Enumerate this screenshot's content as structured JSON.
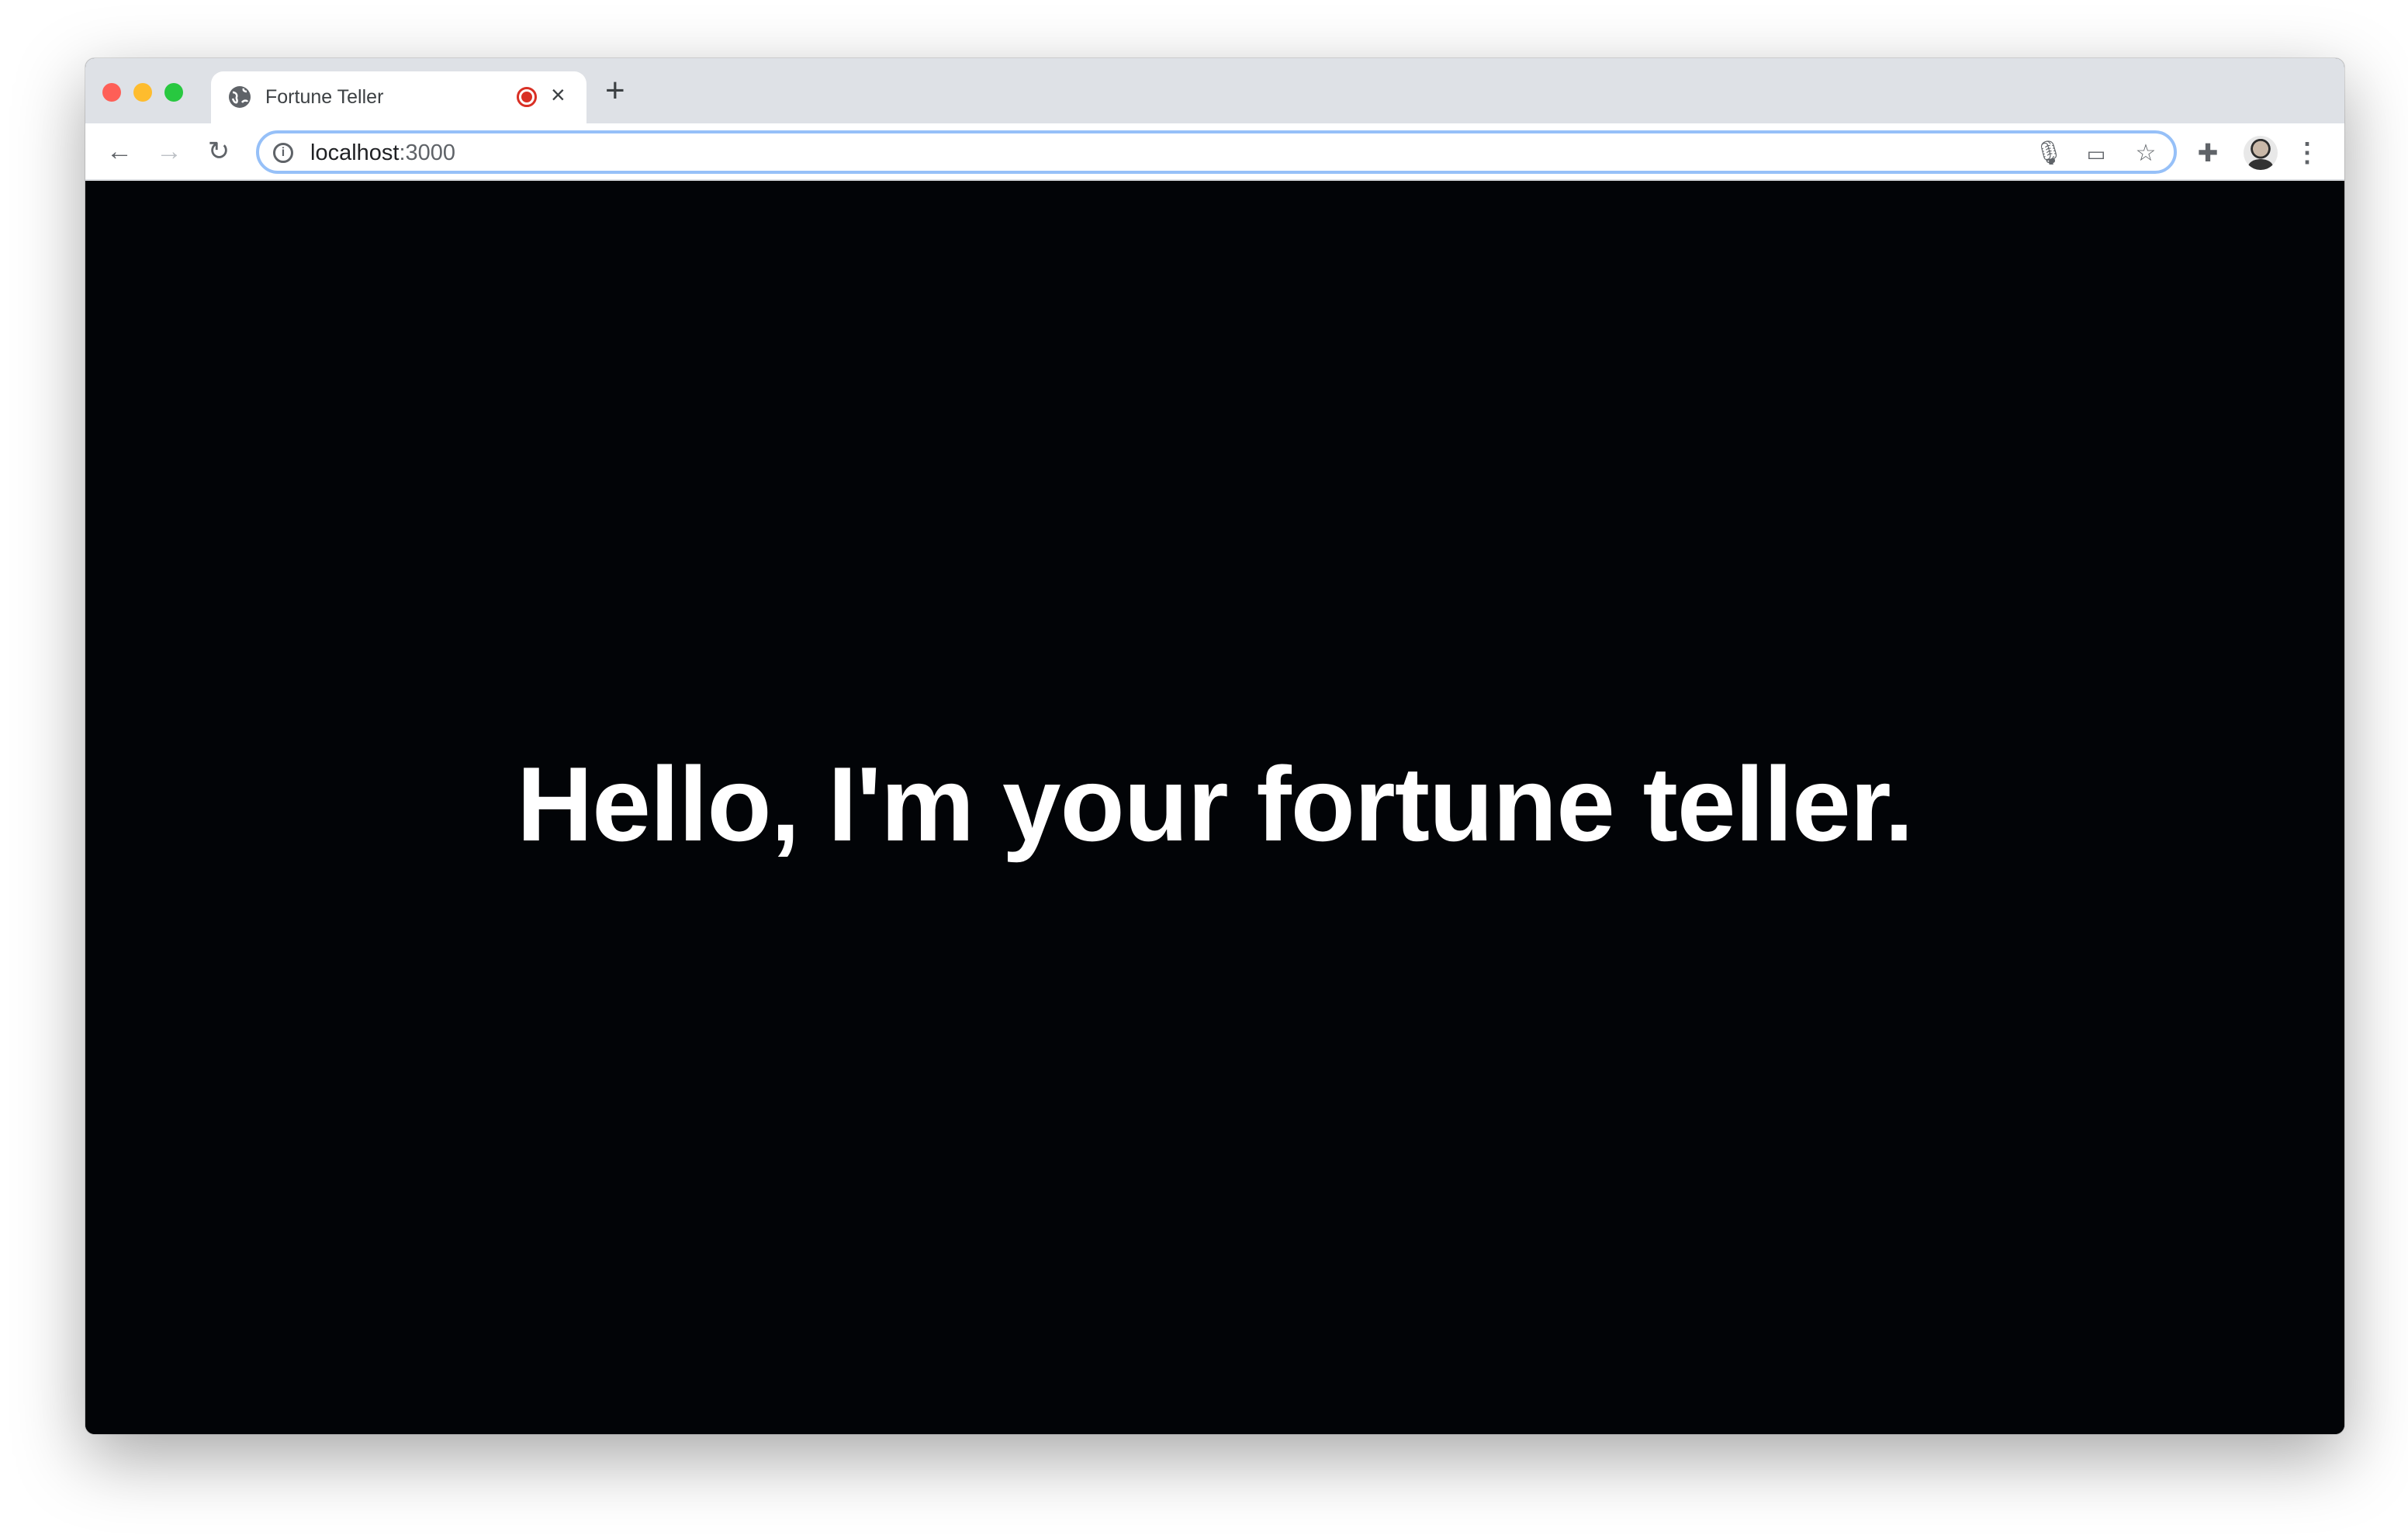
{
  "browser": {
    "tab": {
      "title": "Fortune Teller",
      "close_label": "×",
      "recording_indicator_color": "#d93025"
    },
    "new_tab_label": "+",
    "address": {
      "host": "localhost",
      "port": ":3000"
    },
    "icons": [
      "back-icon",
      "forward-icon",
      "reload-icon",
      "info-icon",
      "microphone-icon",
      "cast-icon",
      "star-icon",
      "extensions-icon",
      "avatar",
      "menu-icon"
    ]
  },
  "page": {
    "heading": "Hello, I'm your fortune teller.",
    "background": "#020407"
  }
}
